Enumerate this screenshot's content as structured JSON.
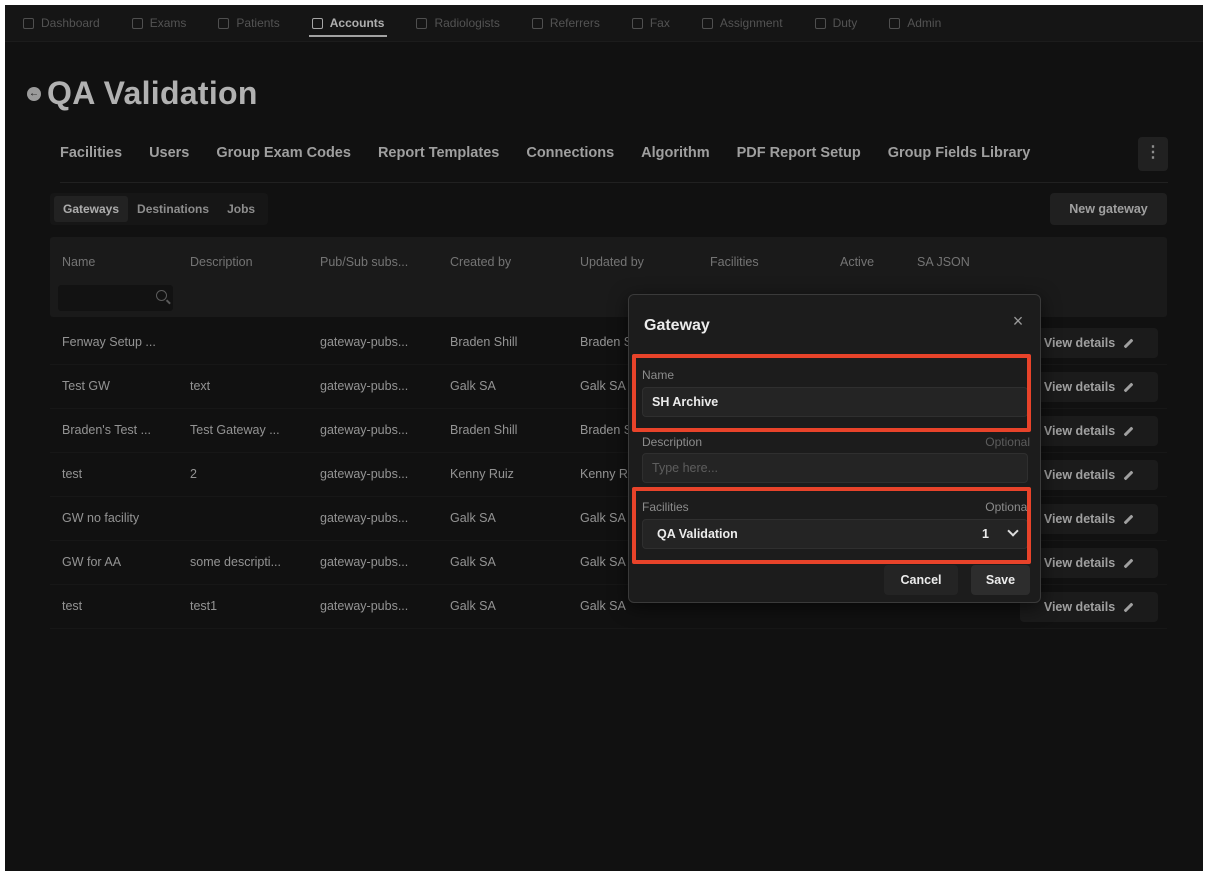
{
  "nav": {
    "items": [
      {
        "label": "Dashboard",
        "icon": "dashboard-icon"
      },
      {
        "label": "Exams",
        "icon": "exams-icon"
      },
      {
        "label": "Patients",
        "icon": "patients-icon"
      },
      {
        "label": "Accounts",
        "icon": "accounts-icon",
        "active": true
      },
      {
        "label": "Radiologists",
        "icon": "radiologists-icon"
      },
      {
        "label": "Referrers",
        "icon": "referrers-icon"
      },
      {
        "label": "Fax",
        "icon": "fax-icon"
      },
      {
        "label": "Assignment",
        "icon": "assignment-icon"
      },
      {
        "label": "Duty",
        "icon": "duty-icon"
      },
      {
        "label": "Admin",
        "icon": "admin-icon"
      }
    ]
  },
  "page": {
    "title": "QA Validation",
    "back_icon": "←"
  },
  "tabs": [
    "Facilities",
    "Users",
    "Group Exam Codes",
    "Report Templates",
    "Connections",
    "Algorithm",
    "PDF Report Setup",
    "Group Fields Library"
  ],
  "more_icon": "⋮",
  "subtabs": [
    {
      "label": "Gateways",
      "active": true
    },
    {
      "label": "Destinations"
    },
    {
      "label": "Jobs"
    }
  ],
  "new_gateway_label": "New gateway",
  "table": {
    "columns": [
      "Name",
      "Description",
      "Pub/Sub subs...",
      "Created by",
      "Updated by",
      "Facilities",
      "Active",
      "SA JSON"
    ],
    "view_details_label": "View details",
    "rows": [
      {
        "name": "Fenway Setup ...",
        "description": "",
        "pubsub": "gateway-pubs...",
        "created_by": "Braden Shill",
        "updated_by": "Braden Shill"
      },
      {
        "name": "Test GW",
        "description": "text",
        "pubsub": "gateway-pubs...",
        "created_by": "Galk SA",
        "updated_by": "Galk SA"
      },
      {
        "name": "Braden's Test ...",
        "description": "Test Gateway ...",
        "pubsub": "gateway-pubs...",
        "created_by": "Braden Shill",
        "updated_by": "Braden Shill"
      },
      {
        "name": "test",
        "description": "2",
        "pubsub": "gateway-pubs...",
        "created_by": "Kenny Ruiz",
        "updated_by": "Kenny Ruiz"
      },
      {
        "name": "GW no facility",
        "description": "",
        "pubsub": "gateway-pubs...",
        "created_by": "Galk SA",
        "updated_by": "Galk SA"
      },
      {
        "name": "GW for AA",
        "description": "some descripti...",
        "pubsub": "gateway-pubs...",
        "created_by": "Galk SA",
        "updated_by": "Galk SA"
      },
      {
        "name": "test",
        "description": "test1",
        "pubsub": "gateway-pubs...",
        "created_by": "Galk SA",
        "updated_by": "Galk SA"
      }
    ]
  },
  "dialog": {
    "title": "Gateway",
    "close_icon": "×",
    "name_label": "Name",
    "name_value": "SH Archive",
    "description_label": "Description",
    "description_optional": "Optional",
    "description_placeholder": "Type here...",
    "facilities_label": "Facilities",
    "facilities_optional": "Optional",
    "facilities_value": "QA Validation",
    "facilities_count": "1",
    "cancel_label": "Cancel",
    "save_label": "Save"
  },
  "colors": {
    "highlight": "#e8432a",
    "background": "#171717"
  }
}
